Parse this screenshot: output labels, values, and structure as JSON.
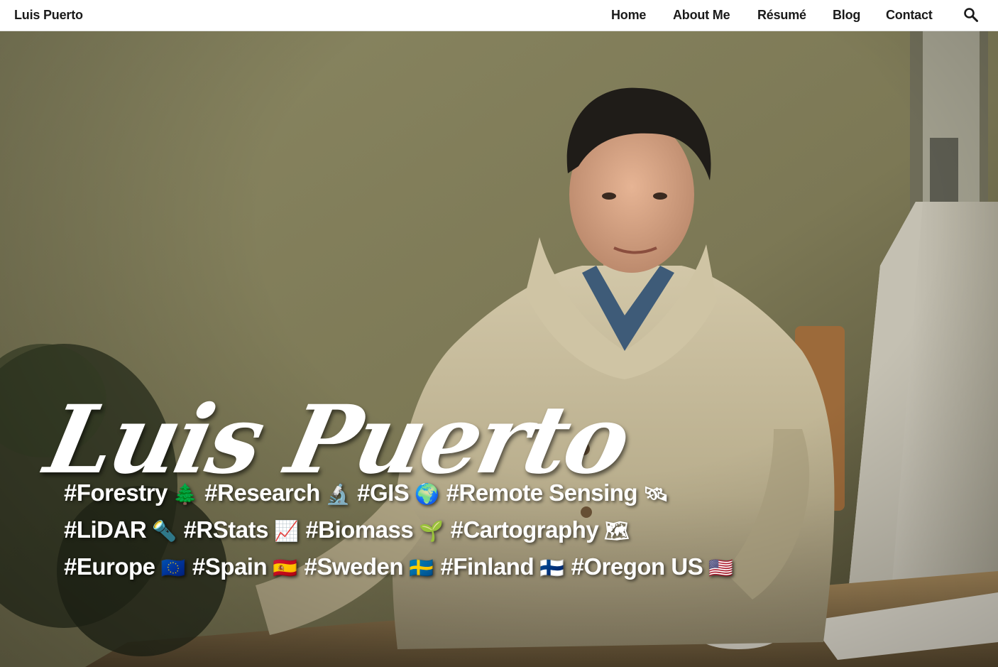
{
  "navbar": {
    "brand": "Luis Puerto",
    "links": [
      {
        "label": "Home"
      },
      {
        "label": "About Me"
      },
      {
        "label": "Résumé"
      },
      {
        "label": "Blog"
      },
      {
        "label": "Contact"
      }
    ],
    "search_icon": "search-icon"
  },
  "hero": {
    "title": "Luis Puerto",
    "tag_lines": [
      [
        {
          "label": "#Forestry",
          "emoji": "🌲"
        },
        {
          "label": "#Research",
          "emoji": "🔬"
        },
        {
          "label": "#GIS",
          "emoji": "🌍"
        },
        {
          "label": "#Remote Sensing",
          "emoji": "🛰"
        }
      ],
      [
        {
          "label": "#LiDAR",
          "emoji": "🔦"
        },
        {
          "label": "#RStats",
          "emoji": "📈"
        },
        {
          "label": "#Biomass",
          "emoji": "🌱"
        },
        {
          "label": "#Cartography",
          "emoji": "🗺"
        }
      ],
      [
        {
          "label": "#Europe",
          "emoji": "🇪🇺"
        },
        {
          "label": "#Spain",
          "emoji": "🇪🇸"
        },
        {
          "label": "#Sweden",
          "emoji": "🇸🇪"
        },
        {
          "label": "#Finland",
          "emoji": "🇫🇮"
        },
        {
          "label": "#Oregon US",
          "emoji": "🇺🇸"
        }
      ]
    ]
  },
  "colors": {
    "navbar_bg": "#ffffff",
    "nav_text": "#1a1a1a",
    "hero_text": "#ffffff",
    "wall": "#85825f",
    "sweater": "#c9bea0"
  }
}
